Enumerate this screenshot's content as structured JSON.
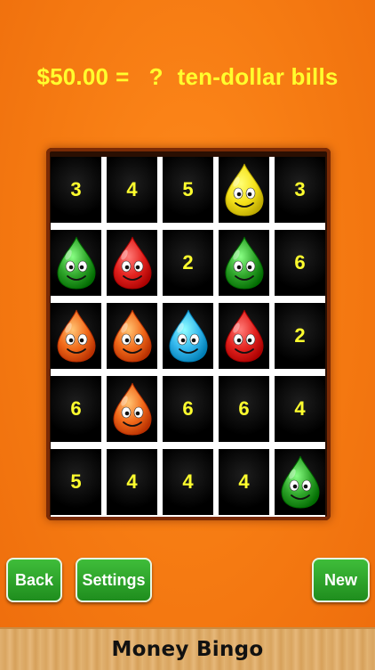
{
  "question": {
    "amount": "$50.00",
    "equals": "=",
    "mark": "?",
    "unit": "ten-dollar bills"
  },
  "board": {
    "rows": [
      [
        {
          "type": "number",
          "value": "3"
        },
        {
          "type": "number",
          "value": "4"
        },
        {
          "type": "number",
          "value": "5"
        },
        {
          "type": "drop",
          "color": "#f6e21a"
        },
        {
          "type": "number",
          "value": "3"
        }
      ],
      [
        {
          "type": "drop",
          "color": "#2fa52a"
        },
        {
          "type": "drop",
          "color": "#e4231f"
        },
        {
          "type": "number",
          "value": "2"
        },
        {
          "type": "drop",
          "color": "#2fa52a"
        },
        {
          "type": "number",
          "value": "6"
        }
      ],
      [
        {
          "type": "drop",
          "color": "#f26a1a"
        },
        {
          "type": "drop",
          "color": "#f26a1a"
        },
        {
          "type": "drop",
          "color": "#35b8ee"
        },
        {
          "type": "drop",
          "color": "#e4231f"
        },
        {
          "type": "number",
          "value": "2"
        }
      ],
      [
        {
          "type": "number",
          "value": "6"
        },
        {
          "type": "drop",
          "color": "#f26a1a"
        },
        {
          "type": "number",
          "value": "6"
        },
        {
          "type": "number",
          "value": "6"
        },
        {
          "type": "number",
          "value": "4"
        }
      ],
      [
        {
          "type": "number",
          "value": "5"
        },
        {
          "type": "number",
          "value": "4"
        },
        {
          "type": "number",
          "value": "4"
        },
        {
          "type": "number",
          "value": "4"
        },
        {
          "type": "drop",
          "color": "#2fa52a"
        }
      ]
    ]
  },
  "buttons": {
    "back": "Back",
    "settings": "Settings",
    "new": "New"
  },
  "footer": {
    "title": "Money Bingo"
  },
  "colors": {
    "background": "#f57a12",
    "question_text": "#ffff2e",
    "cell_number": "#ffff2e",
    "button": "#2a9d27"
  }
}
